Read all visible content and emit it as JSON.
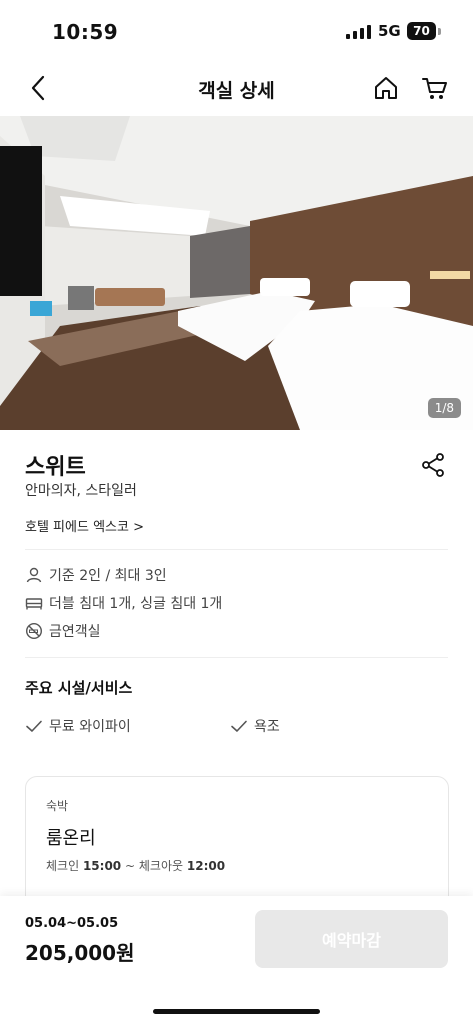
{
  "status_bar": {
    "time": "10:59",
    "network": "5G",
    "battery": "70"
  },
  "nav": {
    "title": "객실 상세",
    "back_icon": "chevron-left-icon",
    "home_icon": "home-icon",
    "cart_icon": "cart-icon"
  },
  "gallery": {
    "counter": "1/8"
  },
  "room": {
    "name": "스위트",
    "description": "안마의자, 스타일러",
    "hotel_link": "호텔 피에드 엑스코 >"
  },
  "info": [
    {
      "icon": "person-icon",
      "text": "기준 2인 / 최대 3인"
    },
    {
      "icon": "bed-icon",
      "text": "더블 침대 1개, 싱글 침대 1개"
    },
    {
      "icon": "no-smoking-icon",
      "text": "금연객실"
    }
  ],
  "amenities": {
    "title": "주요 시설/서비스",
    "items": [
      {
        "label": "무료 와이파이"
      },
      {
        "label": "욕조"
      }
    ]
  },
  "stay_card": {
    "type": "숙박",
    "title": "룸온리",
    "checkin_label": "체크인",
    "checkin_time": "15:00",
    "separator": "~",
    "checkout_label": "체크아웃",
    "checkout_time": "12:00"
  },
  "booking": {
    "dates": "05.04~05.05",
    "price": "205,000원",
    "button": "예약마감"
  }
}
